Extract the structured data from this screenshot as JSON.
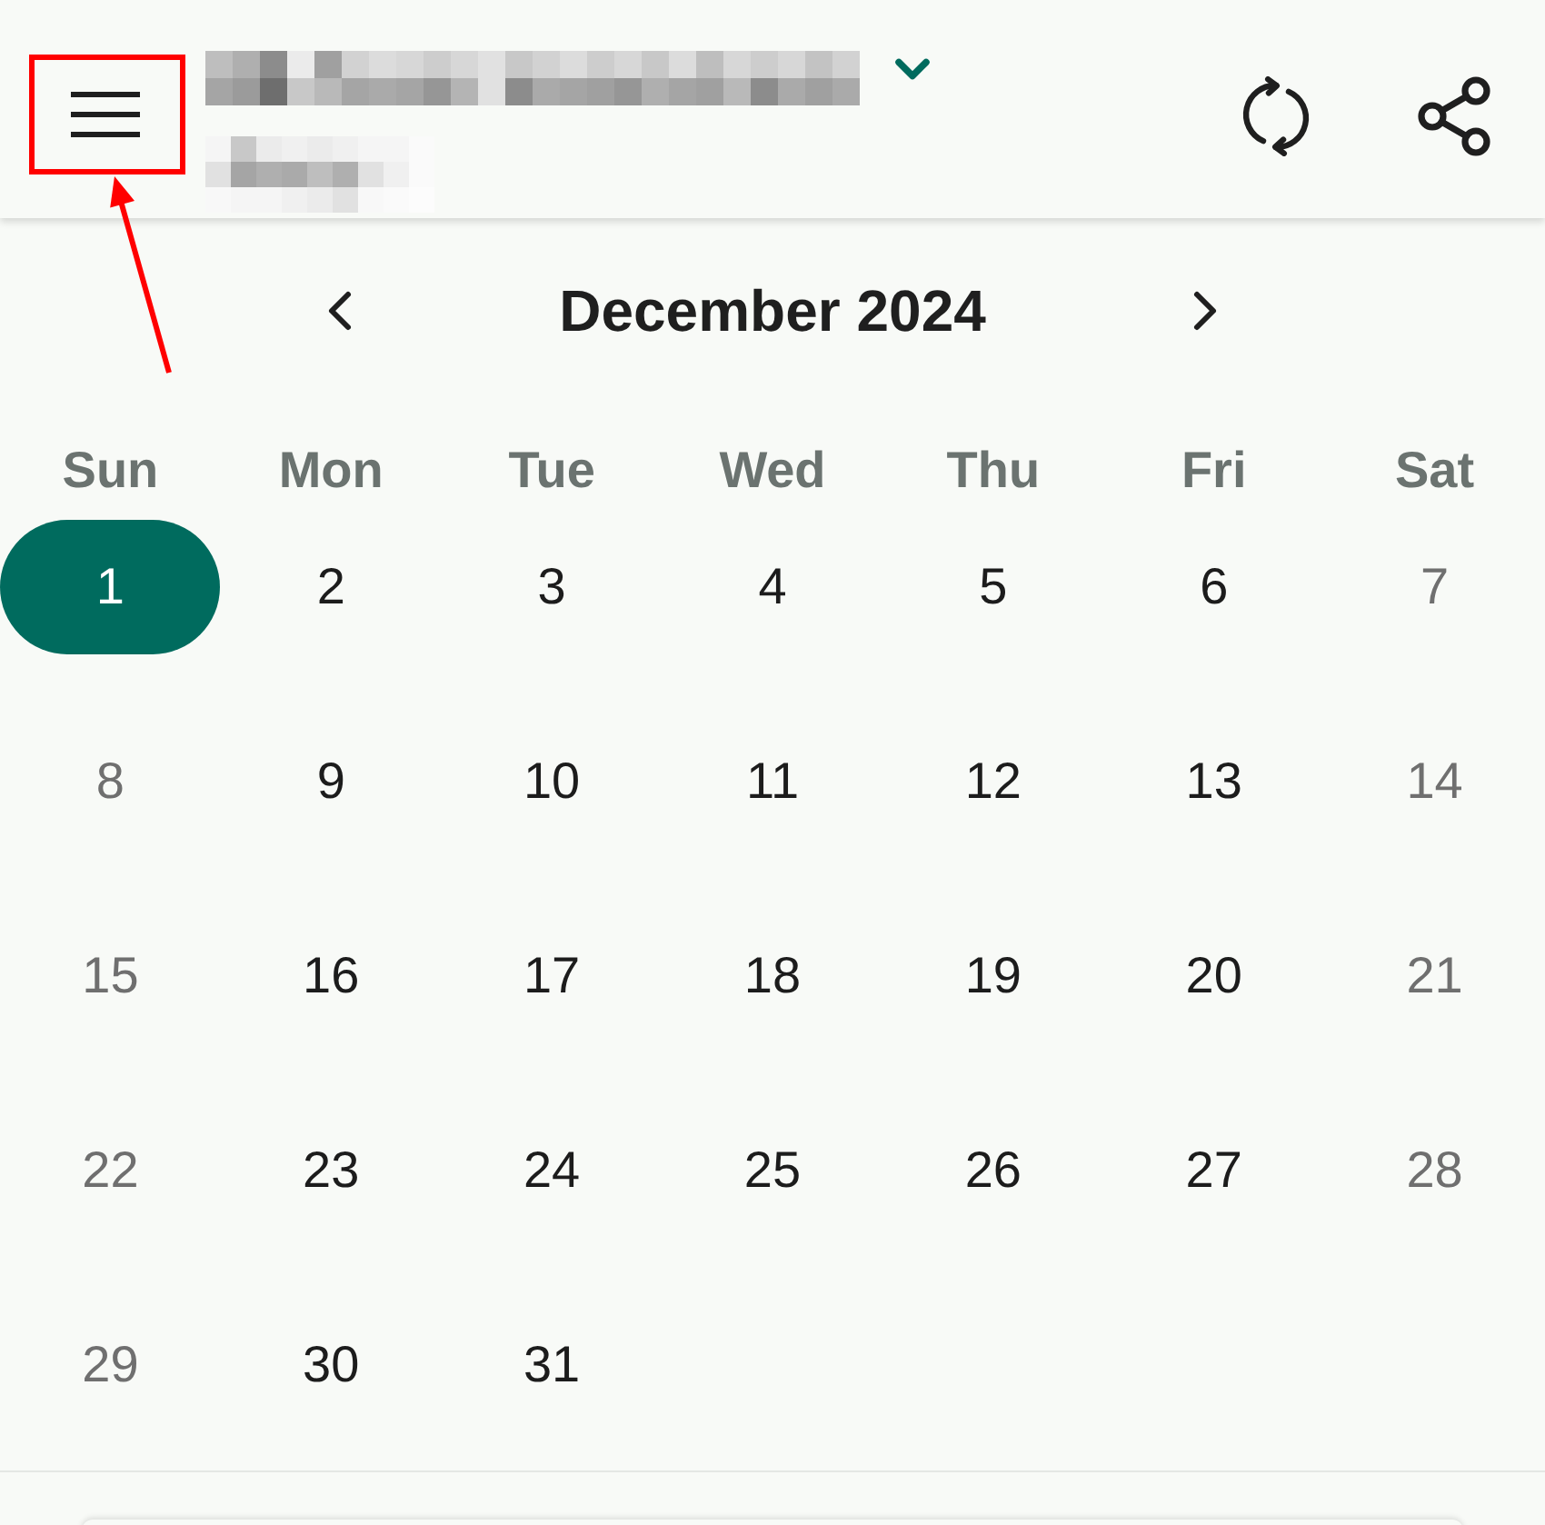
{
  "header": {
    "title": {
      "kind": "pixelated"
    },
    "subtitle": {
      "kind": "pixelated"
    },
    "has_dropdown": true
  },
  "calendar": {
    "month_title": "December 2024",
    "weekdays": [
      {
        "label": "Sun",
        "weekend": true
      },
      {
        "label": "Mon",
        "weekend": false
      },
      {
        "label": "Tue",
        "weekend": false
      },
      {
        "label": "Wed",
        "weekend": false
      },
      {
        "label": "Thu",
        "weekend": false
      },
      {
        "label": "Fri",
        "weekend": false
      },
      {
        "label": "Sat",
        "weekend": true
      }
    ],
    "weeks": [
      [
        {
          "label": "1",
          "selected": true
        },
        {
          "label": "2",
          "selected": false
        },
        {
          "label": "3",
          "selected": false
        },
        {
          "label": "4",
          "selected": false
        },
        {
          "label": "5",
          "selected": false
        },
        {
          "label": "6",
          "selected": false
        },
        {
          "label": "7",
          "selected": false
        }
      ],
      [
        {
          "label": "8",
          "selected": false
        },
        {
          "label": "9",
          "selected": false
        },
        {
          "label": "10",
          "selected": false
        },
        {
          "label": "11",
          "selected": false
        },
        {
          "label": "12",
          "selected": false
        },
        {
          "label": "13",
          "selected": false
        },
        {
          "label": "14",
          "selected": false
        }
      ],
      [
        {
          "label": "15",
          "selected": false
        },
        {
          "label": "16",
          "selected": false
        },
        {
          "label": "17",
          "selected": false
        },
        {
          "label": "18",
          "selected": false
        },
        {
          "label": "19",
          "selected": false
        },
        {
          "label": "20",
          "selected": false
        },
        {
          "label": "21",
          "selected": false
        }
      ],
      [
        {
          "label": "22",
          "selected": false
        },
        {
          "label": "23",
          "selected": false
        },
        {
          "label": "24",
          "selected": false
        },
        {
          "label": "25",
          "selected": false
        },
        {
          "label": "26",
          "selected": false
        },
        {
          "label": "27",
          "selected": false
        },
        {
          "label": "28",
          "selected": false
        }
      ],
      [
        {
          "label": "29",
          "selected": false
        },
        {
          "label": "30",
          "selected": false
        },
        {
          "label": "31",
          "selected": false
        }
      ]
    ]
  },
  "annotations": {
    "highlight_box": true,
    "arrow": true
  }
}
